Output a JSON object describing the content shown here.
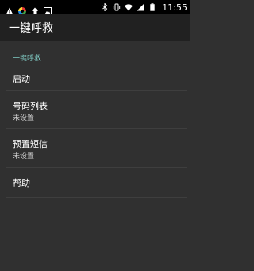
{
  "status_bar": {
    "time": "11:55",
    "left_icons": [
      "warning-icon",
      "colorwheel-app-icon",
      "upload-icon",
      "image-icon"
    ],
    "right_icons": [
      "bluetooth-icon",
      "vibrate-icon",
      "wifi-icon",
      "signal-icon",
      "battery-icon"
    ]
  },
  "appbar": {
    "title": "一键呼救"
  },
  "settings": {
    "section_header": "一键呼救",
    "items": [
      {
        "title": "启动",
        "summary": ""
      },
      {
        "title": "号码列表",
        "summary": "未设置"
      },
      {
        "title": "预置短信",
        "summary": "未设置"
      },
      {
        "title": "帮助",
        "summary": ""
      }
    ]
  },
  "colors": {
    "accent": "#80cbc4",
    "background": "#303030",
    "appbar": "#212121",
    "statusbar": "#000000"
  }
}
